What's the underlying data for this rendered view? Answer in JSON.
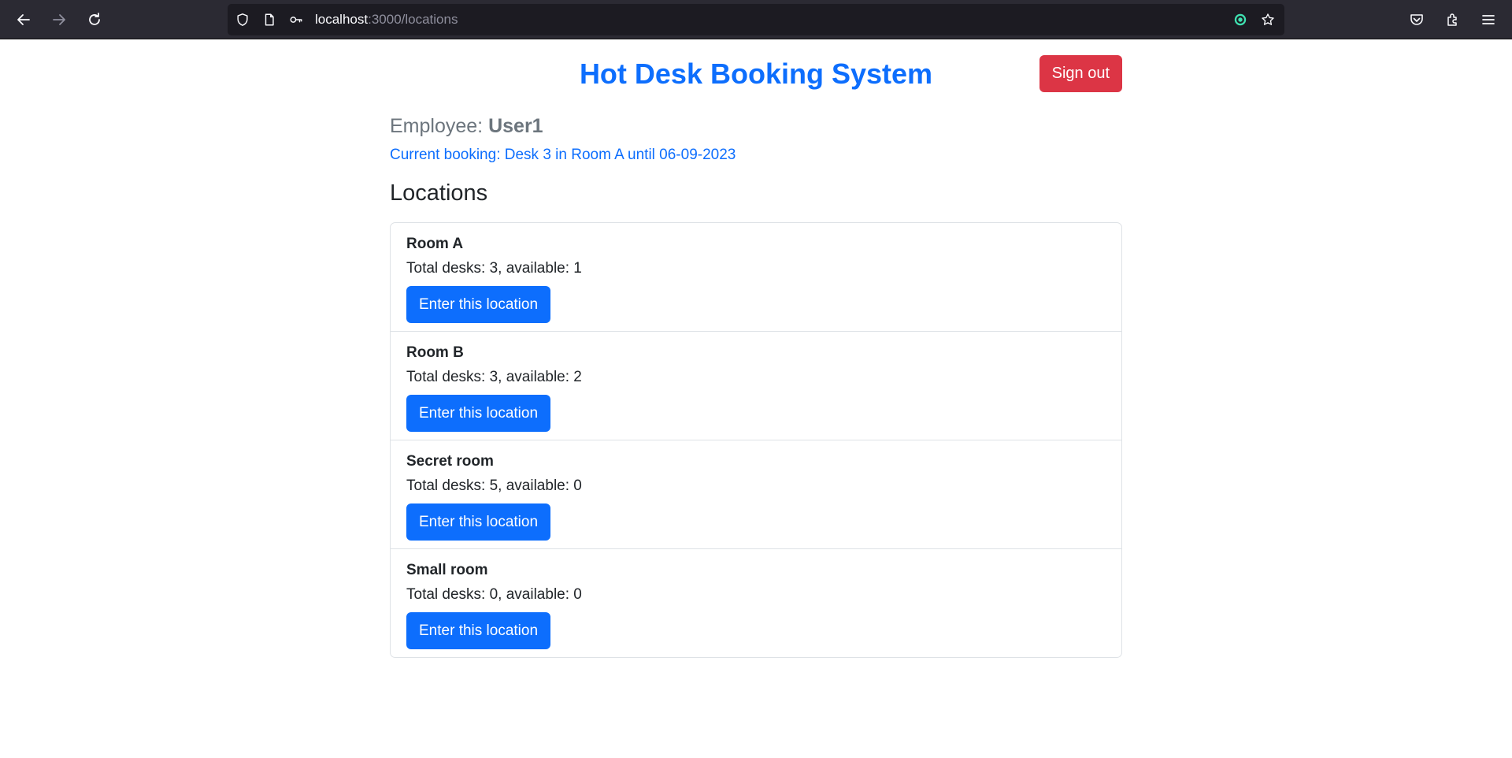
{
  "browser": {
    "url_host": "localhost",
    "url_rest": ":3000/locations",
    "icons": {
      "back": "arrow-left-icon",
      "forward": "arrow-right-icon",
      "reload": "reload-icon",
      "shield": "tracking-protection-shield-icon",
      "page": "page-info-icon",
      "key": "key-icon",
      "extension_target": "target-icon",
      "bookmark": "star-icon",
      "pocket": "pocket-icon",
      "extensions": "puzzle-icon",
      "menu": "hamburger-menu-icon"
    }
  },
  "header": {
    "title": "Hot Desk Booking System",
    "signout_label": "Sign out"
  },
  "employee": {
    "label": "Employee:",
    "name": "User1"
  },
  "current_booking": "Current booking: Desk 3 in Room A until 06-09-2023",
  "locations_heading": "Locations",
  "locations": [
    {
      "name": "Room A",
      "desks": "Total desks: 3, available: 1",
      "button": "Enter this location"
    },
    {
      "name": "Room B",
      "desks": "Total desks: 3, available: 2",
      "button": "Enter this location"
    },
    {
      "name": "Secret room",
      "desks": "Total desks: 5, available: 0",
      "button": "Enter this location"
    },
    {
      "name": "Small room",
      "desks": "Total desks: 0, available: 0",
      "button": "Enter this location"
    }
  ],
  "colors": {
    "primary": "#0d6efd",
    "danger": "#dc3545",
    "secondary_text": "#6c757d",
    "body_text": "#212529",
    "chrome_bg": "#2b2a33",
    "urlbar_bg": "#1c1b22"
  }
}
